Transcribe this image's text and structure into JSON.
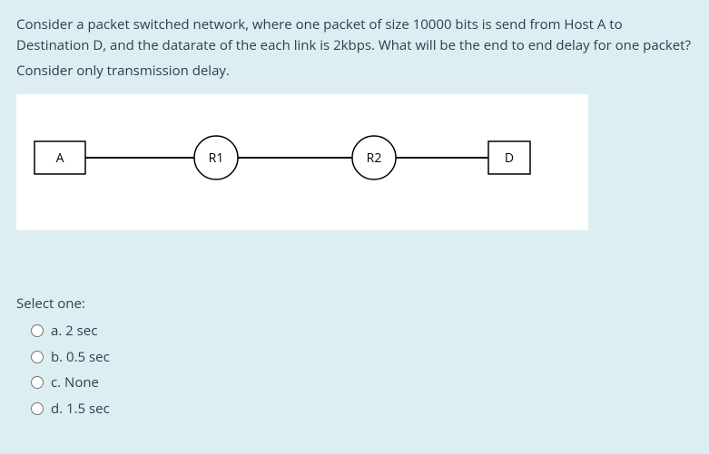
{
  "question": {
    "para1": "Consider a packet switched network, where one packet of size 10000 bits is send from Host A to Destination D, and the datarate of the each link is 2kbps. What will be the end to end delay for one packet?",
    "para2": "Consider only transmission delay."
  },
  "diagram": {
    "nodes": {
      "host_a": "A",
      "router1": "R1",
      "router2": "R2",
      "host_d": "D"
    }
  },
  "select_label": "Select one:",
  "options": {
    "a": "a. 2 sec",
    "b": "b. 0.5 sec",
    "c": "c. None",
    "d": "d. 1.5 sec"
  }
}
